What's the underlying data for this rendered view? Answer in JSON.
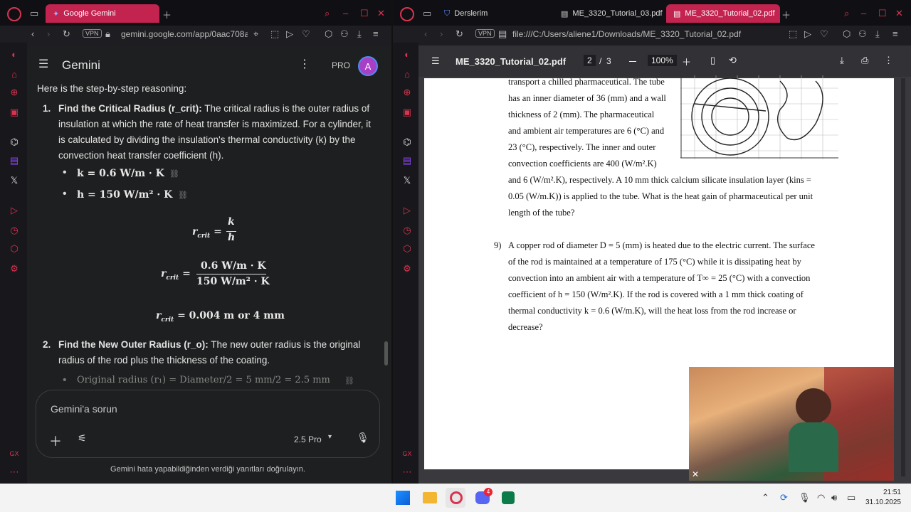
{
  "left": {
    "tab_title": "Google Gemini",
    "url": "gemini.google.com/app/0aac708a",
    "vpn": "VPN",
    "app_name": "Gemini",
    "pro_badge": "PRO",
    "avatar_letter": "A",
    "intro": "Here is the step-by-step reasoning:",
    "step1_num": "1.",
    "step1_title": "Find the Critical Radius (r_crit):",
    "step1_text": "The critical radius is the outer radius of insulation at which the rate of heat transfer is maximized. For a cylinder, it is calculated by dividing the insulation's thermal conductivity (k) by the convection heat transfer coefficient (h).",
    "bullet_k": "k = 0.6 W/m · K",
    "bullet_h": "h = 150 W/m² · K",
    "eq1_lhs": "r",
    "eq1_sub": "crit",
    "eq1_num": "k",
    "eq1_den": "h",
    "eq2_num": "0.6 W/m · K",
    "eq2_den": "150 W/m² · K",
    "eq3_rhs": "= 0.004 m or 4 mm",
    "step2_num": "2.",
    "step2_title": "Find the New Outer Radius (r_o):",
    "step2_text": "The new outer radius is the original radius of the rod plus the thickness of the coating.",
    "bullet_orig": "Original radius (r₁) = Diameter/2 = 5 mm/2 = 2.5 mm",
    "input_placeholder": "Gemini'a sorun",
    "model": "2.5 Pro",
    "disclaimer": "Gemini hata yapabildiğinden verdiği yanıtları doğrulayın."
  },
  "right": {
    "tabs": [
      "Derslerim",
      "ME_3320_Tutorial_03.pdf",
      "ME_3320_Tutorial_02.pdf"
    ],
    "url": "file:///C:/Users/aliene1/Downloads/ME_3320_Tutorial_02.pdf",
    "vpn": "VPN",
    "pdf_title": "ME_3320_Tutorial_02.pdf",
    "page_current": "2",
    "page_sep": "/",
    "page_total": "3",
    "zoom": "100%",
    "p8_lines": [
      "transport a chilled pharmaceutical. The tube",
      "has an inner diameter of 36 (mm) and a wall",
      "thickness of 2 (mm). The pharmaceutical",
      "and ambient air temperatures are 6 (°C) and",
      "23 (°C), respectively. The inner and outer",
      "convection coefficients are 400 (W/m².K)",
      "and 6 (W/m².K), respectively. A 10 mm thick calcium silicate insulation layer (kins =",
      "0.05 (W/m.K)) is applied to the tube. What is the heat gain of pharmaceutical per unit",
      "length of the tube?"
    ],
    "p9_num": "9)",
    "p9_lines": [
      "A copper rod of diameter D = 5 (mm) is heated due to the electric current. The surface",
      "of the rod is maintained at a temperature of 175 (°C) while it is dissipating heat by",
      "convection into an ambient air with a temperature of T∞ =  25 (°C) with a convection",
      "coefficient of      h = 150 (W/m².K). If the rod is covered with a 1 mm thick coating of",
      "thermal conductivity k = 0.6 (W/m.K), will the heat loss from the rod increase or",
      "decrease?"
    ]
  },
  "taskbar": {
    "time": "21:51",
    "date": "31.10.2025",
    "badge": "4"
  }
}
